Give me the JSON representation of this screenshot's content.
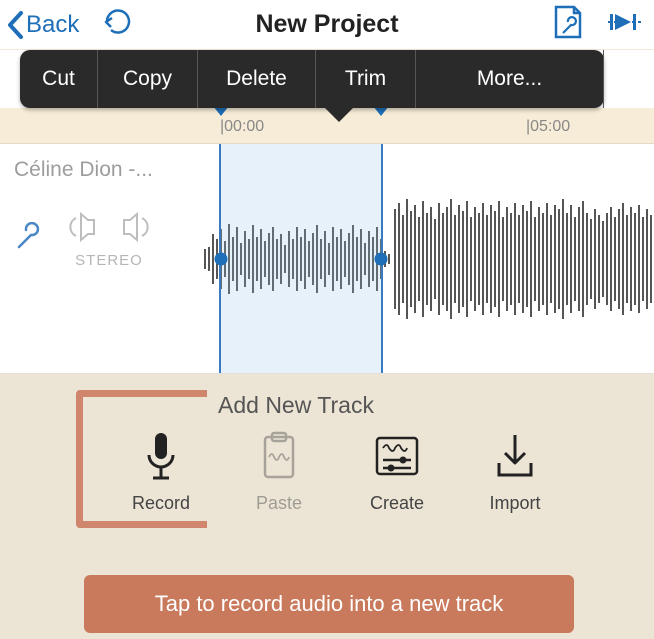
{
  "nav": {
    "back_label": "Back",
    "title": "New Project"
  },
  "toolbar": {
    "cut": "Cut",
    "copy": "Copy",
    "delete": "Delete",
    "trim": "Trim",
    "more": "More..."
  },
  "ruler": {
    "tick0": "|00:00",
    "tick5": "|05:00"
  },
  "track": {
    "name": "Céline Dion -...",
    "stereo_label": "STEREO"
  },
  "panel": {
    "title": "Add New Track",
    "record": "Record",
    "paste": "Paste",
    "create": "Create",
    "import": "Import"
  },
  "tip": "Tap to record audio into a new track"
}
